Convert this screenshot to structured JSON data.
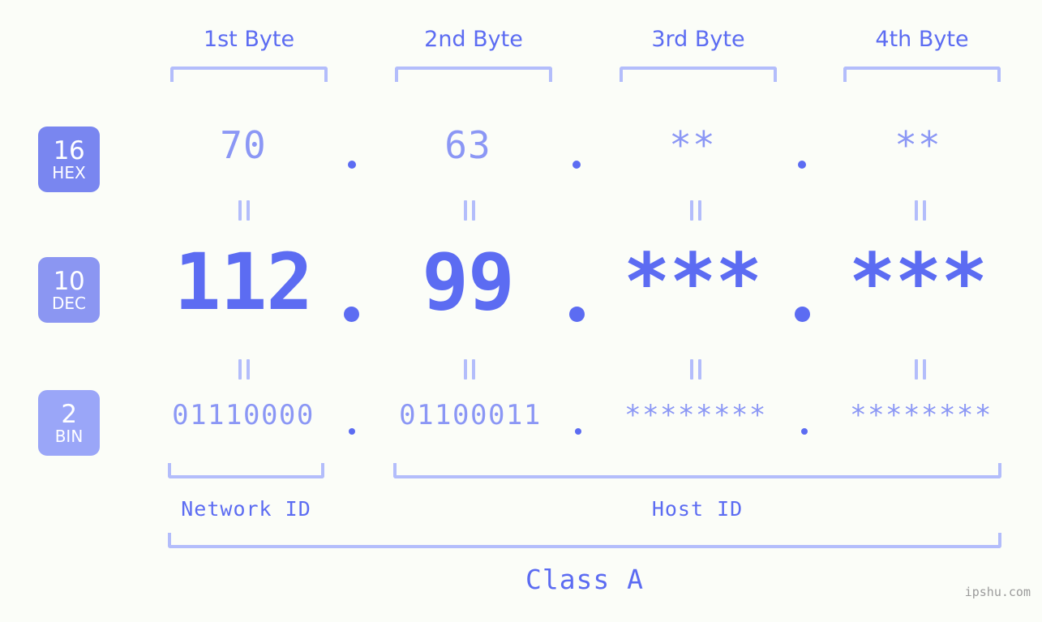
{
  "watermark": "ipshu.com",
  "colors": {
    "background": "#fbfdf8",
    "accent_strong": "#5c6cf2",
    "accent_mid": "#8b97f5",
    "accent_light": "#b3bdfb",
    "badge_hex": "#7986f0",
    "badge_dec": "#8b96f2",
    "badge_bin": "#9aa6f8"
  },
  "byte_headers": [
    {
      "label": "1st Byte"
    },
    {
      "label": "2nd Byte"
    },
    {
      "label": "3rd Byte"
    },
    {
      "label": "4th Byte"
    }
  ],
  "bases": [
    {
      "number": "16",
      "name": "HEX"
    },
    {
      "number": "10",
      "name": "DEC"
    },
    {
      "number": "2",
      "name": "BIN"
    }
  ],
  "rows": {
    "hex": {
      "base_number": "16",
      "base_name": "HEX",
      "values": [
        "70",
        "63",
        "**",
        "**"
      ],
      "separators": [
        ".",
        ".",
        "."
      ]
    },
    "dec": {
      "base_number": "10",
      "base_name": "DEC",
      "values": [
        "112",
        "99",
        "***",
        "***"
      ],
      "separators": [
        ".",
        ".",
        "."
      ]
    },
    "bin": {
      "base_number": "2",
      "base_name": "BIN",
      "values": [
        "01110000",
        "01100011",
        "********",
        "********"
      ],
      "separators": [
        ".",
        ".",
        "."
      ]
    }
  },
  "equals_marks": {
    "hex_to_dec": [
      "=",
      "=",
      "=",
      "="
    ],
    "dec_to_bin": [
      "=",
      "=",
      "=",
      "="
    ]
  },
  "partition": {
    "network_id_label": "Network ID",
    "host_id_label": "Host ID",
    "class_label": "Class A"
  }
}
